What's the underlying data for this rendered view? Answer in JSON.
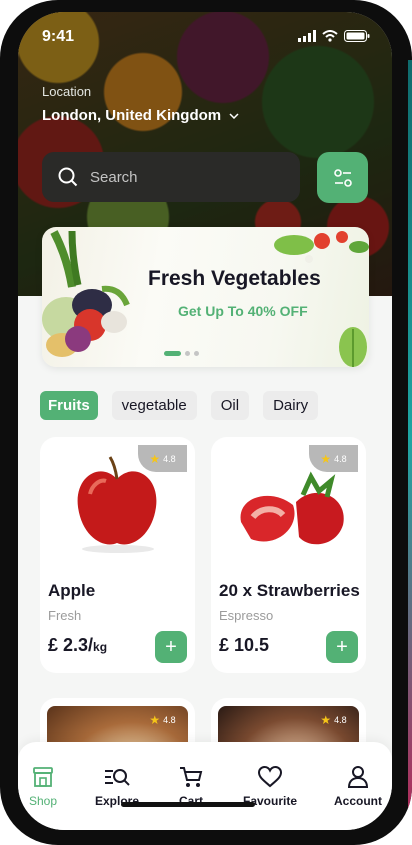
{
  "status": {
    "time": "9:41"
  },
  "location": {
    "label": "Location",
    "value": "London, United Kingdom"
  },
  "search": {
    "placeholder": "Search"
  },
  "banner": {
    "title": "Fresh Vegetables",
    "subtitle": "Get Up To 40% OFF"
  },
  "categories": [
    "Fruits",
    "vegetable",
    "Oil",
    "Dairy"
  ],
  "products": [
    {
      "name": "Apple",
      "subtitle": "Fresh",
      "price": "£ 2.3/",
      "unit": "kg",
      "rating": "4.8"
    },
    {
      "name": "20 x Strawberries",
      "subtitle": "Espresso",
      "price": "£ 10.5",
      "unit": "",
      "rating": "4.8"
    },
    {
      "rating": "4.8"
    },
    {
      "rating": "4.8"
    }
  ],
  "nav": [
    {
      "label": "Shop"
    },
    {
      "label": "Explore"
    },
    {
      "label": "Cart"
    },
    {
      "label": "Favourite"
    },
    {
      "label": "Account"
    }
  ],
  "colors": {
    "accent": "#53b175",
    "text": "#181725",
    "muted": "#9b9b9b"
  }
}
